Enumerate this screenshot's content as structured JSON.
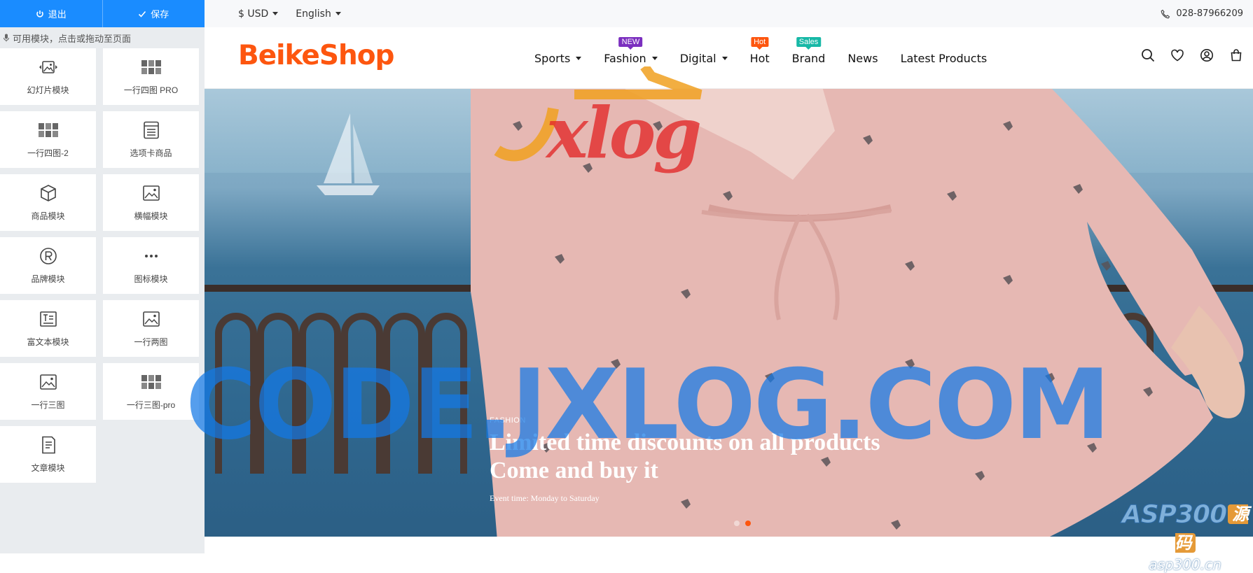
{
  "editor": {
    "exit_label": "退出",
    "save_label": "保存",
    "hint": "可用模块，点击或拖动至页面",
    "modules": [
      {
        "label": "幻灯片模块",
        "icon": "slideshow-icon"
      },
      {
        "label": "一行四图 PRO",
        "icon": "four-images-icon"
      },
      {
        "label": "一行四图-2",
        "icon": "four-images-icon"
      },
      {
        "label": "选项卡商品",
        "icon": "tabs-list-icon"
      },
      {
        "label": "商品模块",
        "icon": "product-box-icon"
      },
      {
        "label": "横幅模块",
        "icon": "image-icon"
      },
      {
        "label": "品牌模块",
        "icon": "registered-icon"
      },
      {
        "label": "图标模块",
        "icon": "dots-icon"
      },
      {
        "label": "富文本模块",
        "icon": "rich-text-icon"
      },
      {
        "label": "一行两图",
        "icon": "image-icon"
      },
      {
        "label": "一行三图",
        "icon": "image-icon"
      },
      {
        "label": "一行三图-pro",
        "icon": "four-images-icon"
      },
      {
        "label": "文章模块",
        "icon": "article-icon"
      }
    ]
  },
  "topbar": {
    "currency": "$ USD",
    "language": "English",
    "phone": "028-87966209"
  },
  "header": {
    "logo": "BeikeShop",
    "nav": [
      {
        "label": "Sports",
        "dropdown": true,
        "badge": ""
      },
      {
        "label": "Fashion",
        "dropdown": true,
        "badge": "NEW",
        "badge_color": "#7b2fbf"
      },
      {
        "label": "Digital",
        "dropdown": true,
        "badge": ""
      },
      {
        "label": "Hot",
        "dropdown": false,
        "badge": "Hot",
        "badge_color": "#fd560f"
      },
      {
        "label": "Brand",
        "dropdown": false,
        "badge": "Sales",
        "badge_color": "#17b8a6"
      },
      {
        "label": "News",
        "dropdown": false,
        "badge": ""
      },
      {
        "label": "Latest Products",
        "dropdown": false,
        "badge": ""
      }
    ],
    "icons": [
      "search-icon",
      "heart-icon",
      "account-icon",
      "cart-icon"
    ]
  },
  "hero": {
    "tag": "FASHION",
    "title_line1": "Limited time discounts on all products",
    "title_line2": "Come and buy it",
    "subtitle": "Event time: Monday to Saturday",
    "slides": 2,
    "active_slide": 2
  },
  "watermarks": {
    "main": "CODE.JXLOG.COM",
    "logo": "Jxlog",
    "asp_brand": "ASP300",
    "asp_cn": "源码",
    "asp_url": "asp300.cn"
  },
  "colors": {
    "accent": "#fd560f",
    "editor_blue": "#1a8cff"
  }
}
